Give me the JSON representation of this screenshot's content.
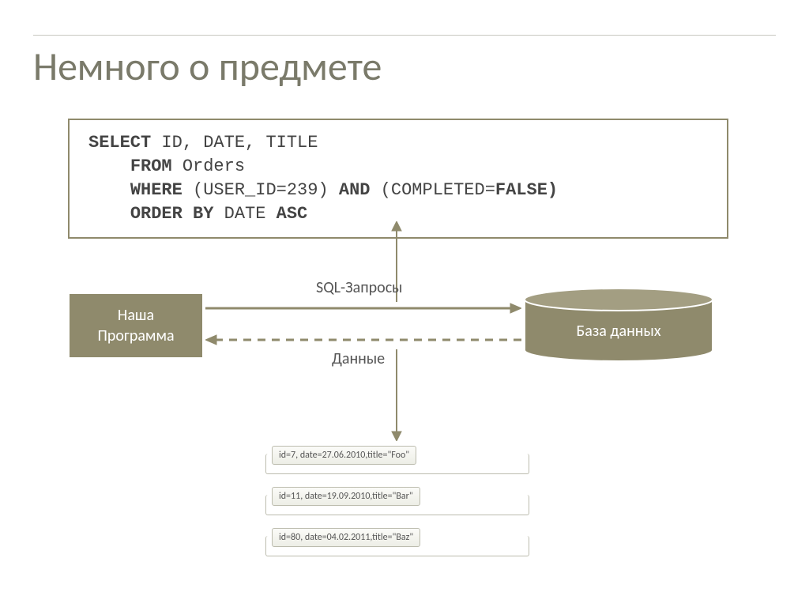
{
  "title": "Немного о предмете",
  "sql": {
    "parts": [
      {
        "t": "SELECT",
        "b": true
      },
      {
        "t": " ID, DATE, TITLE\n",
        "b": false
      },
      {
        "t": "    ",
        "b": false
      },
      {
        "t": "FROM",
        "b": true
      },
      {
        "t": " Orders\n",
        "b": false
      },
      {
        "t": "    ",
        "b": false
      },
      {
        "t": "WHERE",
        "b": true
      },
      {
        "t": " (USER_ID=239) ",
        "b": false
      },
      {
        "t": "AND",
        "b": true
      },
      {
        "t": " (COMPLETED=",
        "b": false
      },
      {
        "t": "FALSE)",
        "b": true
      },
      {
        "t": "\n",
        "b": false
      },
      {
        "t": "    ",
        "b": false
      },
      {
        "t": "ORDER BY",
        "b": true
      },
      {
        "t": " DATE ",
        "b": false
      },
      {
        "t": "ASC",
        "b": true
      }
    ]
  },
  "program_label": "Наша\nПрограмма",
  "db_label": "База данных",
  "arrow_sql_label": "SQL-Запросы",
  "arrow_data_label": "Данные",
  "results": [
    {
      "text": "id=7, date=27.06.2010,title=\"Foo\""
    },
    {
      "text": "id=11, date=19.09.2010,title=\"Bar\""
    },
    {
      "text": "id=80, date=04.02.2011,title=\"Baz\""
    }
  ],
  "colors": {
    "olive": "#8F8A6C",
    "text": "#555555"
  }
}
